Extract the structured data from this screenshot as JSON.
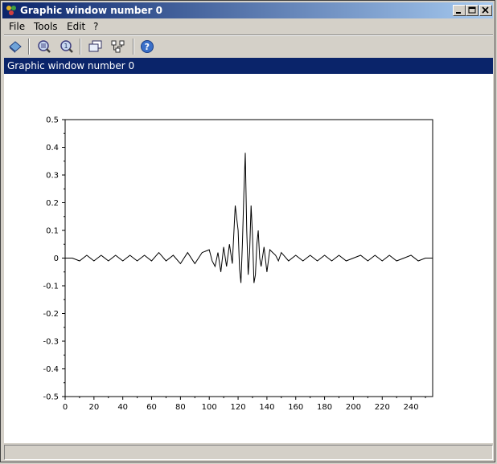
{
  "window": {
    "title": "Graphic window number 0",
    "controls": [
      "minimize",
      "maximize",
      "close"
    ]
  },
  "menubar": {
    "items": [
      "File",
      "Tools",
      "Edit",
      "?"
    ]
  },
  "toolbar": {
    "buttons": [
      "rotate-icon",
      "zoom-icon",
      "unzoom-icon",
      "datatip-icon",
      "editor-icon",
      "help-icon"
    ]
  },
  "panel": {
    "header": "Graphic window number 0"
  },
  "chart_data": {
    "type": "line",
    "title": "",
    "xlabel": "",
    "ylabel": "",
    "xlim": [
      0,
      255
    ],
    "ylim": [
      -0.5,
      0.5
    ],
    "xticks": [
      "0",
      "20",
      "40",
      "60",
      "80",
      "100",
      "120",
      "140",
      "160",
      "180",
      "200",
      "220",
      "240"
    ],
    "yticks": [
      "-0.5",
      "-0.4",
      "-0.3",
      "-0.2",
      "-0.1",
      "0",
      "0.1",
      "0.2",
      "0.3",
      "0.4",
      "0.5"
    ],
    "grid": false,
    "series": [
      {
        "color": "#000000",
        "x": [
          0,
          5,
          10,
          15,
          20,
          25,
          30,
          35,
          40,
          45,
          50,
          55,
          60,
          65,
          70,
          75,
          80,
          85,
          90,
          95,
          100,
          102,
          104,
          106,
          108,
          110,
          112,
          114,
          116,
          118,
          120,
          121,
          122,
          123,
          124,
          125,
          126,
          127,
          128,
          129,
          130,
          131,
          132,
          133,
          134,
          135,
          136,
          138,
          140,
          142,
          144,
          146,
          148,
          150,
          155,
          160,
          165,
          170,
          175,
          180,
          185,
          190,
          195,
          200,
          205,
          210,
          215,
          220,
          225,
          230,
          235,
          240,
          245,
          250,
          255
        ],
        "y": [
          0.0,
          0.0,
          -0.01,
          0.01,
          -0.01,
          0.01,
          -0.01,
          0.01,
          -0.01,
          0.01,
          -0.01,
          0.01,
          -0.01,
          0.02,
          -0.01,
          0.01,
          -0.02,
          0.02,
          -0.02,
          0.02,
          0.03,
          -0.01,
          -0.03,
          0.02,
          -0.05,
          0.04,
          -0.03,
          0.05,
          -0.02,
          0.19,
          0.1,
          -0.04,
          -0.09,
          0.05,
          0.23,
          0.38,
          0.1,
          -0.06,
          0.02,
          0.19,
          0.08,
          -0.09,
          -0.06,
          0.05,
          0.1,
          0.0,
          -0.03,
          0.04,
          -0.05,
          0.03,
          0.02,
          0.01,
          -0.01,
          0.02,
          -0.01,
          0.01,
          -0.01,
          0.01,
          -0.01,
          0.01,
          -0.01,
          0.01,
          -0.01,
          0.0,
          0.01,
          -0.01,
          0.01,
          -0.01,
          0.01,
          -0.01,
          0.0,
          0.01,
          -0.01,
          0.0,
          0.0
        ]
      }
    ]
  }
}
